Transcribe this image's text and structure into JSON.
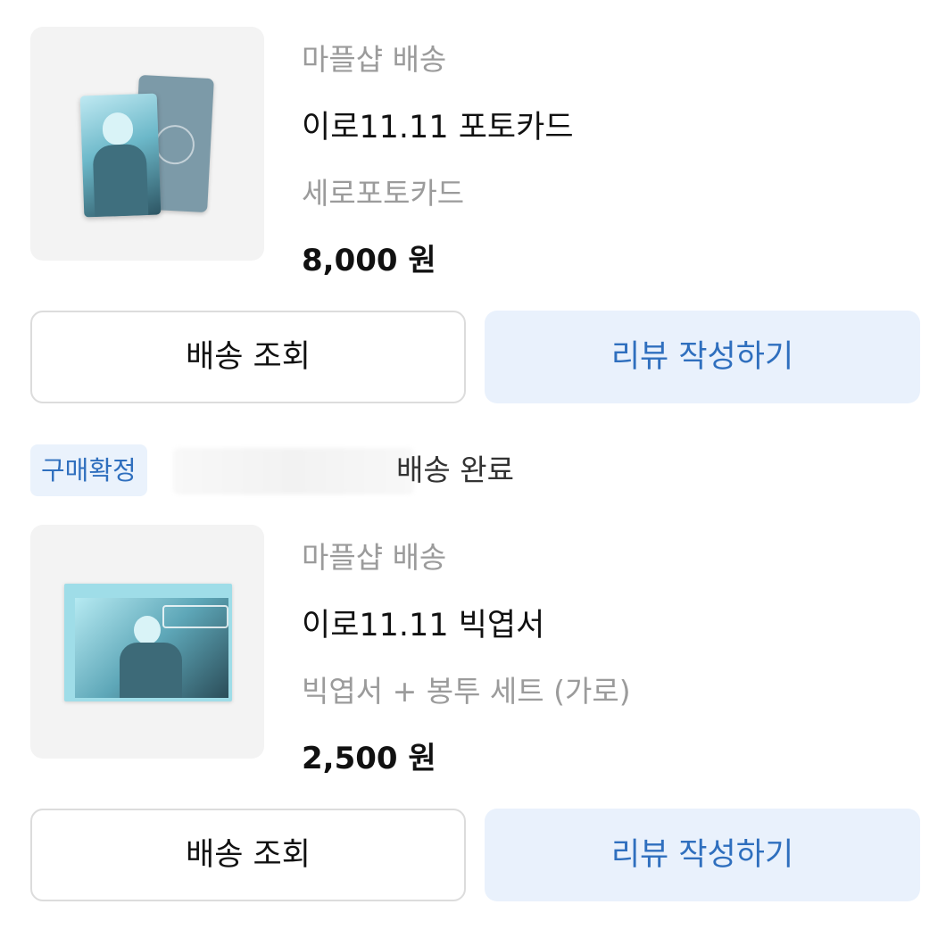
{
  "orders": [
    {
      "product": {
        "shop": "마플샵 배송",
        "title": "이로11.11 포토카드",
        "option": "세로포토카드",
        "price": "8,000 원",
        "thumbnail": "photocard-image"
      },
      "buttons": {
        "track": "배송 조회",
        "review": "리뷰 작성하기"
      }
    },
    {
      "badge": "구매확정",
      "status": "배송 완료",
      "product": {
        "shop": "마플샵 배송",
        "title": "이로11.11 빅엽서",
        "option": "빅엽서 + 봉투 세트 (가로)",
        "price": "2,500 원",
        "thumbnail": "postcard-image"
      },
      "buttons": {
        "track": "배송 조회",
        "review": "리뷰 작성하기"
      }
    }
  ],
  "colors": {
    "accent": "#2f6fbe",
    "accent_bg": "#e9f1fc",
    "muted_text": "#9b9b9b",
    "border": "#dcdcdc",
    "thumb_bg": "#f3f3f3"
  }
}
